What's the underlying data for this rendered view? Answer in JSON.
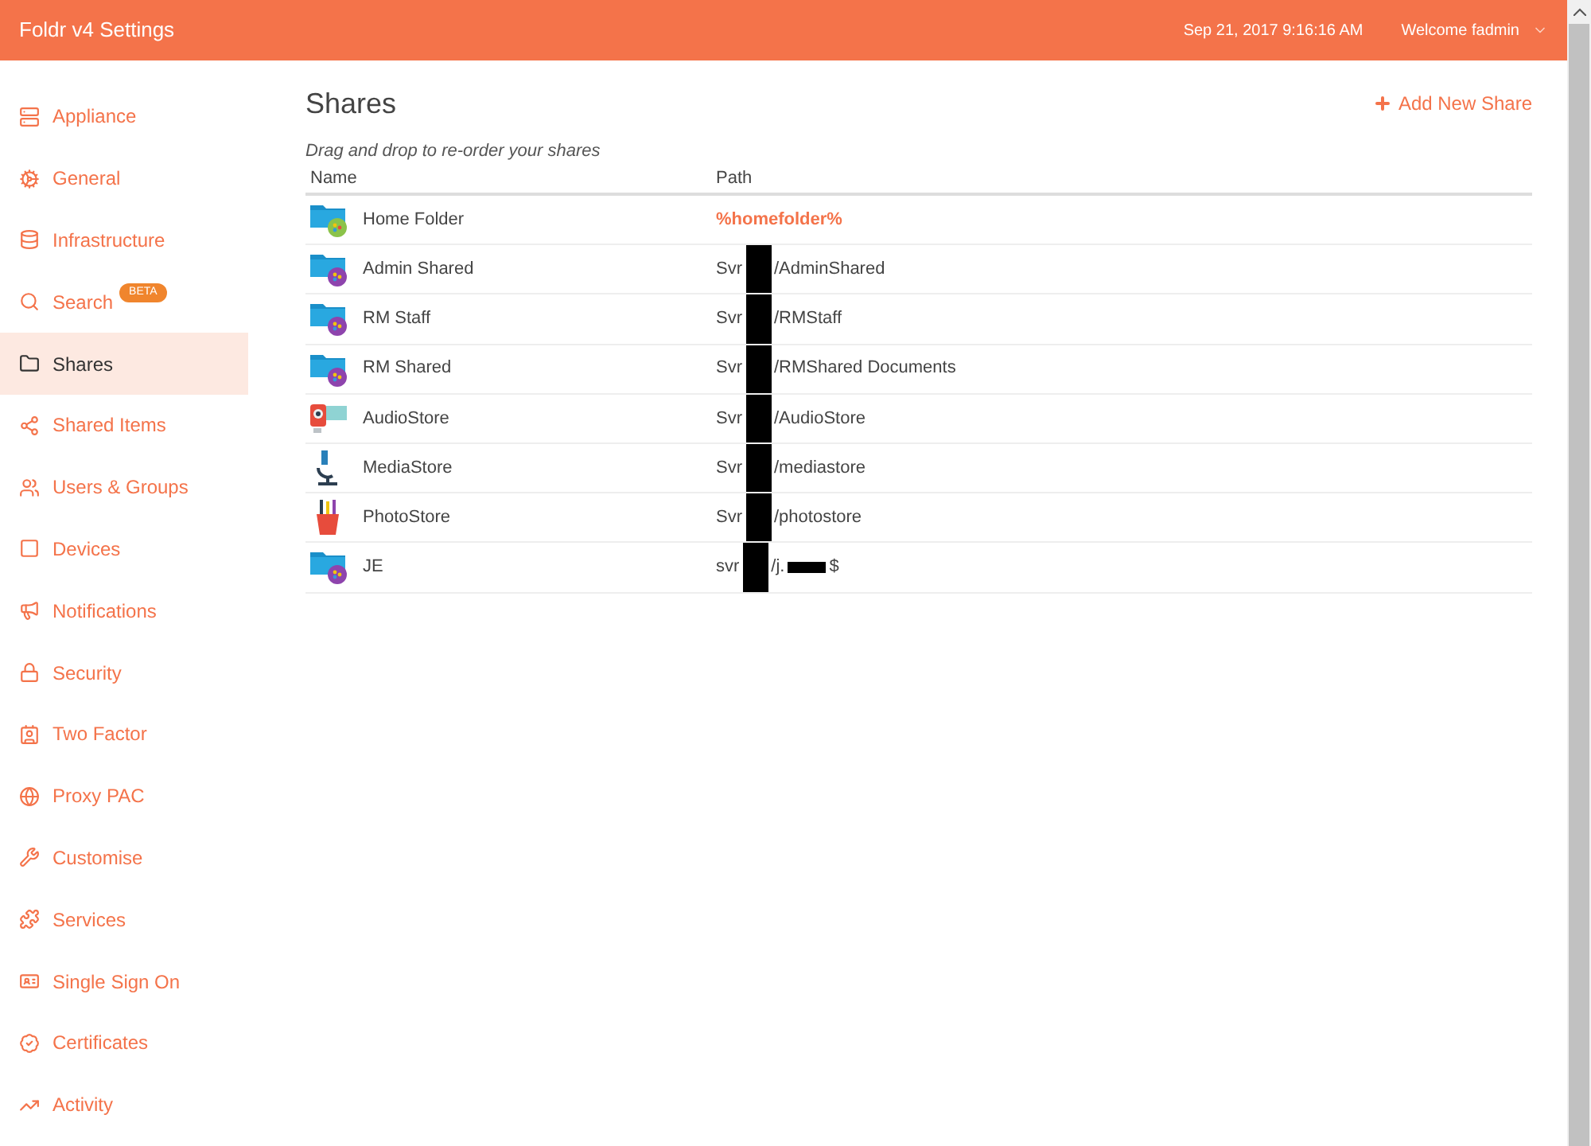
{
  "header": {
    "title": "Foldr v4 Settings",
    "datetime": "Sep 21, 2017 9:16:16 AM",
    "user": "Welcome fadmin"
  },
  "sidebar": {
    "items": [
      {
        "label": "Appliance",
        "selected": false
      },
      {
        "label": "General",
        "selected": false
      },
      {
        "label": "Infrastructure",
        "selected": false
      },
      {
        "label": "Search",
        "selected": false,
        "badge": "BETA"
      },
      {
        "label": "Shares",
        "selected": true
      },
      {
        "label": "Shared Items",
        "selected": false
      },
      {
        "label": "Users & Groups",
        "selected": false
      },
      {
        "label": "Devices",
        "selected": false
      },
      {
        "label": "Notifications",
        "selected": false
      },
      {
        "label": "Security",
        "selected": false
      },
      {
        "label": "Two Factor",
        "selected": false
      },
      {
        "label": "Proxy PAC",
        "selected": false
      },
      {
        "label": "Customise",
        "selected": false
      },
      {
        "label": "Services",
        "selected": false
      },
      {
        "label": "Single Sign On",
        "selected": false
      },
      {
        "label": "Certificates",
        "selected": false
      },
      {
        "label": "Activity",
        "selected": false
      }
    ]
  },
  "main": {
    "title": "Shares",
    "add_button": "Add New Share",
    "hint": "Drag and drop to re-order your shares",
    "table": {
      "columns": [
        "Name",
        "Path"
      ],
      "rows": [
        {
          "kind": "home-folder",
          "name": "Home Folder",
          "path": [
            {
              "kind": "highlight",
              "text": "%homefolder%"
            }
          ]
        },
        {
          "kind": "shared-folder",
          "name": "Admin Shared",
          "path": [
            {
              "kind": "text",
              "text": "Svr"
            },
            {
              "kind": "redacted"
            },
            {
              "kind": "text",
              "text": "/AdminShared"
            }
          ]
        },
        {
          "kind": "shared-folder",
          "name": "RM Staff",
          "path": [
            {
              "kind": "text",
              "text": "Svr"
            },
            {
              "kind": "redacted"
            },
            {
              "kind": "text",
              "text": "/RMStaff"
            }
          ]
        },
        {
          "kind": "shared-folder",
          "name": "RM Shared",
          "path": [
            {
              "kind": "text",
              "text": "Svr"
            },
            {
              "kind": "redacted"
            },
            {
              "kind": "text",
              "text": "/RMShared Documents"
            }
          ]
        },
        {
          "kind": "audio",
          "name": "AudioStore",
          "path": [
            {
              "kind": "text",
              "text": "Svr"
            },
            {
              "kind": "redacted"
            },
            {
              "kind": "text",
              "text": "/AudioStore"
            }
          ]
        },
        {
          "kind": "microscope",
          "name": "MediaStore",
          "path": [
            {
              "kind": "text",
              "text": "Svr"
            },
            {
              "kind": "redacted"
            },
            {
              "kind": "text",
              "text": "/mediastore"
            }
          ]
        },
        {
          "kind": "pencil-cup",
          "name": "PhotoStore",
          "path": [
            {
              "kind": "text",
              "text": "Svr"
            },
            {
              "kind": "redacted"
            },
            {
              "kind": "text",
              "text": "/photostore"
            }
          ]
        },
        {
          "kind": "shared-folder",
          "name": "JE",
          "path": [
            {
              "kind": "text",
              "text": "svr"
            },
            {
              "kind": "redacted"
            },
            {
              "kind": "text",
              "text": "/j."
            },
            {
              "kind": "redacted-small"
            },
            {
              "kind": "text",
              "text": "$"
            }
          ]
        }
      ]
    }
  }
}
